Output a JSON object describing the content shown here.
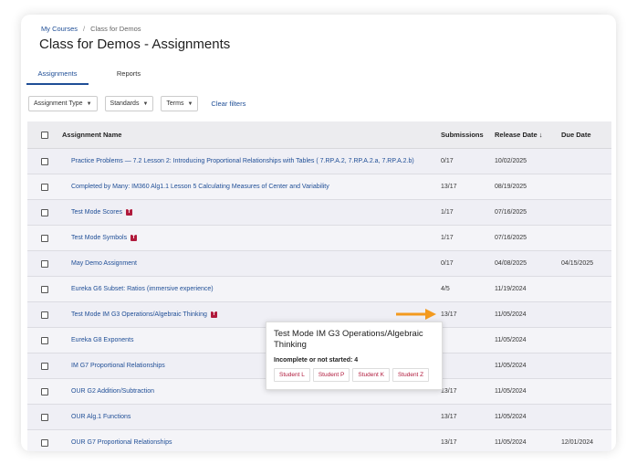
{
  "breadcrumb": {
    "root": "My Courses",
    "separator": "/",
    "current": "Class for Demos"
  },
  "page_title": "Class for Demos - Assignments",
  "tabs": [
    {
      "label": "Assignments"
    },
    {
      "label": "Reports"
    }
  ],
  "filters": {
    "items": [
      {
        "label": "Assignment Type"
      },
      {
        "label": "Standards"
      },
      {
        "label": "Terms"
      }
    ],
    "clear_label": "Clear filters"
  },
  "table": {
    "headers": {
      "name": "Assignment Name",
      "submissions": "Submissions",
      "release": "Release Date",
      "due": "Due Date"
    },
    "rows": [
      {
        "name": "Practice Problems — 7.2 Lesson 2: Introducing Proportional Relationships with Tables ( 7.RP.A.2, 7.RP.A.2.a, 7.RP.A.2.b)",
        "flag": "",
        "submissions": "0/17",
        "release": "10/02/2025",
        "due": ""
      },
      {
        "name": "Completed by Many: IM360 Alg1.1 Lesson 5 Calculating Measures of Center and Variability",
        "flag": "",
        "submissions": "13/17",
        "release": "08/19/2025",
        "due": ""
      },
      {
        "name": "Test Mode Scores",
        "flag": "T",
        "submissions": "1/17",
        "release": "07/16/2025",
        "due": ""
      },
      {
        "name": "Test Mode Symbols",
        "flag": "T",
        "submissions": "1/17",
        "release": "07/16/2025",
        "due": ""
      },
      {
        "name": "May Demo Assignment",
        "flag": "",
        "submissions": "0/17",
        "release": "04/08/2025",
        "due": "04/15/2025"
      },
      {
        "name": "Eureka G6 Subset: Ratios (immersive experience)",
        "flag": "",
        "submissions": "4/5",
        "release": "11/19/2024",
        "due": ""
      },
      {
        "name": "Test Mode IM G3 Operations/Algebraic Thinking",
        "flag": "T",
        "submissions": "13/17",
        "release": "11/05/2024",
        "due": ""
      },
      {
        "name": "Eureka G8 Exponents",
        "flag": "",
        "submissions": "",
        "release": "11/05/2024",
        "due": ""
      },
      {
        "name": "IM G7 Proportional Relationships",
        "flag": "",
        "submissions": "",
        "release": "11/05/2024",
        "due": ""
      },
      {
        "name": "OUR G2 Addition/Subtraction",
        "flag": "",
        "submissions": "13/17",
        "release": "11/05/2024",
        "due": ""
      },
      {
        "name": "OUR Alg.1 Functions",
        "flag": "",
        "submissions": "13/17",
        "release": "11/05/2024",
        "due": ""
      },
      {
        "name": "OUR G7 Proportional Relationships",
        "flag": "",
        "submissions": "13/17",
        "release": "11/05/2024",
        "due": "12/01/2024"
      }
    ]
  },
  "tooltip": {
    "title": "Test Mode IM G3 Operations/Algebraic Thinking",
    "subtitle": "Incomplete or not started: 4",
    "students": [
      "Student L",
      "Student P",
      "Student K",
      "Student Z"
    ]
  },
  "colors": {
    "link": "#1f4e96",
    "flag": "#b01a3c",
    "arrow": "#f39a1f"
  },
  "sort_icon": "arrow-down-icon"
}
